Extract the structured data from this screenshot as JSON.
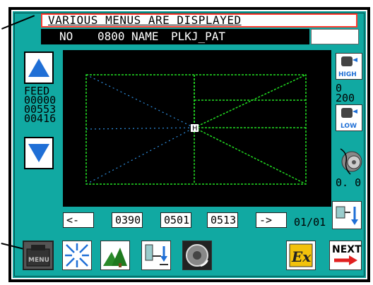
{
  "banner": {
    "text": "VARIOUS MENUS ARE DISPLAYED"
  },
  "info": {
    "no_label": "NO",
    "no_value": "0800",
    "name_label": "NAME",
    "name_value": "PLKJ_PAT"
  },
  "feed": {
    "label": "FEED",
    "values": [
      "00000",
      "00553",
      "00416"
    ]
  },
  "nav": {
    "prev": "<-",
    "next": "->",
    "fields": [
      "0390",
      "0501",
      "0513"
    ],
    "page": "01/01"
  },
  "speed": {
    "high": "HIGH",
    "low": "LOW",
    "value_top": "0",
    "value_bottom": "200",
    "tension": "0. 0"
  },
  "toolbar": {
    "menu": "MENU",
    "next": "NEXT"
  },
  "colors": {
    "panel": "#11a9a2",
    "banner_border": "#ff3b2f",
    "stitch": "#22dd22",
    "guide": "#2f8fe0"
  },
  "icons": [
    "menu-icon",
    "expand-icon",
    "trees-icon",
    "needle-position-icon",
    "wheel-icon",
    "ex-icon",
    "next-arrow-icon",
    "arrow-up-icon",
    "arrow-down-icon",
    "high-speed-icon",
    "low-speed-icon",
    "thread-tension-icon",
    "needle-down-icon"
  ]
}
